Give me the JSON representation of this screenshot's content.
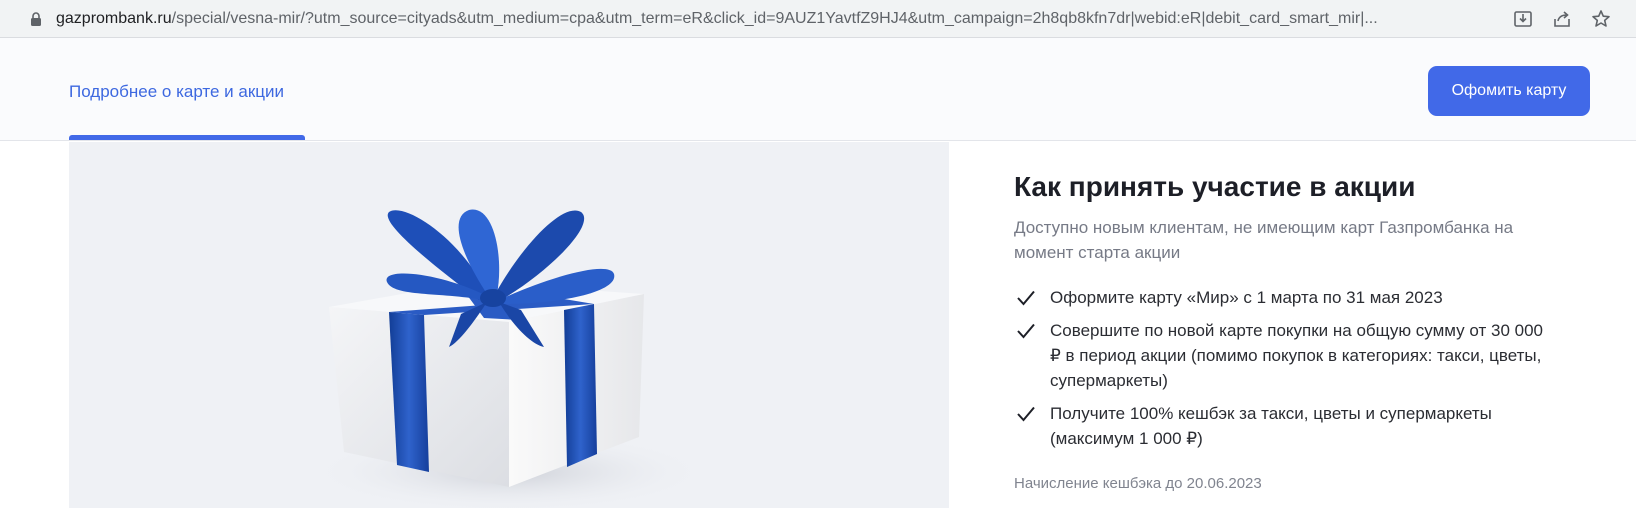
{
  "browser": {
    "url_host": "gazprombank.ru",
    "url_path": "/special/vesna-mir/?utm_source=cityads&utm_medium=cpa&utm_term=eR&click_id=9AUZ1YavtfZ9HJ4&utm_campaign=2h8qb8kfn7dr|webid:eR|debit_card_smart_mir|..."
  },
  "header": {
    "nav_link": "Подробнее о карте и акции",
    "cta_label": "Офомить карту"
  },
  "content": {
    "title": "Как принять участие в акции",
    "subtitle": "Доступно новым клиентам, не имеющим карт Газпромбанка на момент старта акции",
    "steps": [
      "Оформите карту «Мир» с 1 марта по 31 мая 2023",
      "Совершите по новой карте покупки на общую сумму от 30 000 ₽ в период акции (помимо покупок в категориях: такси, цветы, супермаркеты)",
      "Получите 100% кешбэк за такси, цветы и супермаркеты (максимум 1 000 ₽)"
    ],
    "footnote": "Начисление кешбэка до 20.06.2023"
  },
  "colors": {
    "accent": "#4169e8",
    "ribbon": "#1f4fb5",
    "title": "#1d1f27"
  },
  "icons": [
    "lock-icon",
    "install-icon",
    "share-icon",
    "bookmark-star-icon",
    "checkmark-icon",
    "gift-box-image"
  ]
}
